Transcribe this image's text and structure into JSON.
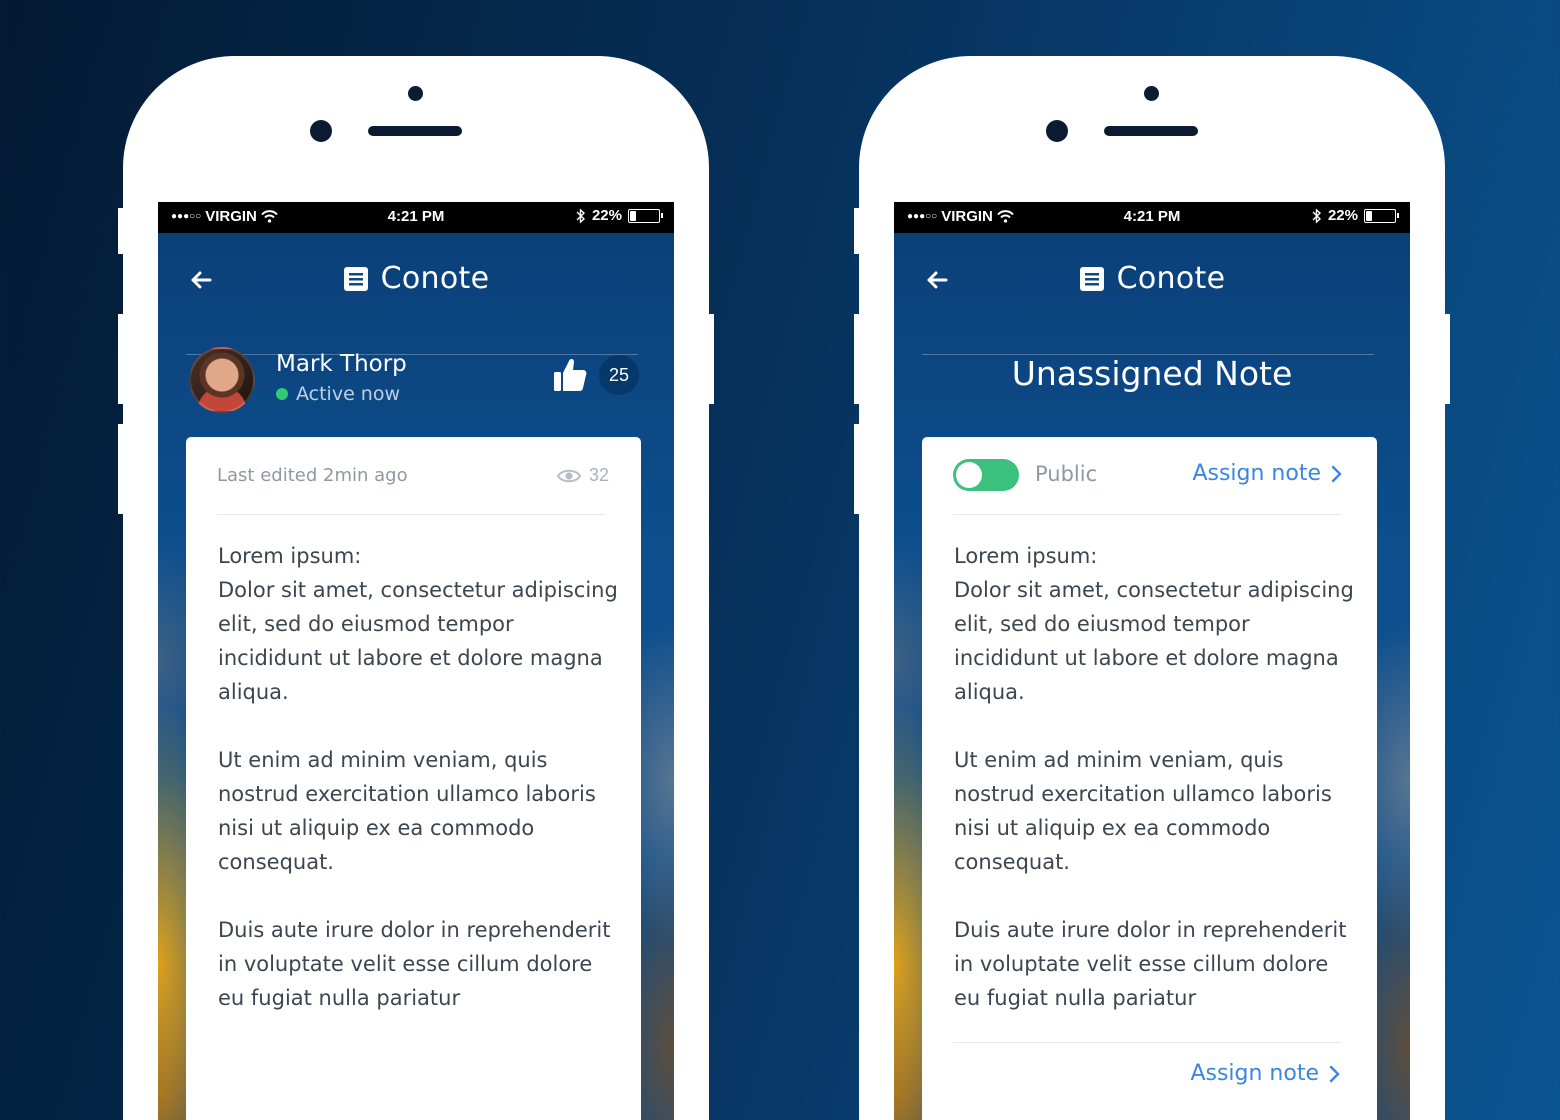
{
  "status_bar": {
    "carrier_dots": "●●●○○",
    "carrier": "VIRGIN",
    "time": "4:21 PM",
    "battery_text": "22%",
    "battery_level": 0.22
  },
  "app": {
    "title": "Conote"
  },
  "left_screen": {
    "user": {
      "name": "Mark Thorp",
      "status": "Active now"
    },
    "likes": "25",
    "meta": "Last edited 2min ago",
    "views": "32",
    "body": [
      "Lorem ipsum:\nDolor sit amet, consectetur adipiscing elit, sed do eiusmod tempor incididunt ut labore et dolore magna aliqua.",
      "Ut enim ad minim veniam, quis nostrud exercitation ullamco laboris nisi ut aliquip ex ea commodo consequat.",
      "Duis aute irure dolor in reprehenderit in voluptate velit esse cillum dolore eu fugiat nulla pariatur"
    ]
  },
  "right_screen": {
    "heading": "Unassigned Note",
    "toggle_label": "Public",
    "toggle_on": true,
    "assign_top": "Assign note",
    "assign_bottom": "Assign note",
    "body": [
      "Lorem ipsum:\nDolor sit amet, consectetur adipiscing elit, sed do eiusmod tempor incididunt ut labore et dolore magna aliqua.",
      "Ut enim ad minim veniam, quis nostrud exercitation ullamco laboris nisi ut aliquip ex ea commodo consequat.",
      "Duis aute irure dolor in reprehenderit in voluptate velit esse cillum dolore eu fugiat nulla pariatur"
    ]
  },
  "colors": {
    "accent": "#3b86e0",
    "toggle_on": "#3cc07d",
    "online": "#32c978"
  }
}
